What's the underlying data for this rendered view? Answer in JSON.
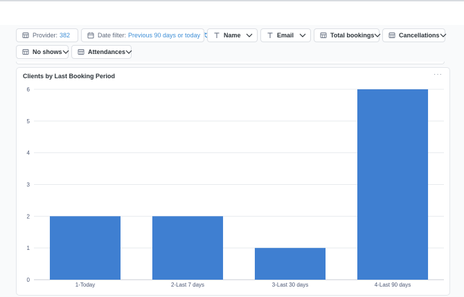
{
  "filters": [
    {
      "icon": "calendar-grid-icon",
      "label": "Provider:",
      "value": "382",
      "has_chevron": false
    },
    {
      "icon": "calendar-icon",
      "label": "Date filter:",
      "value": "Previous 90 days or today",
      "has_reset": true
    },
    {
      "icon": "text-t-icon",
      "label": "Name",
      "has_chevron": true
    },
    {
      "icon": "text-t-icon",
      "label": "Email",
      "has_chevron": true
    },
    {
      "icon": "calendar-grid-icon",
      "label": "Total bookings",
      "has_chevron": true
    },
    {
      "icon": "calendar-grid-icon",
      "label": "Cancellations",
      "has_chevron": true
    },
    {
      "icon": "calendar-grid-icon",
      "label": "No shows",
      "has_chevron": true
    },
    {
      "icon": "calendar-grid-icon",
      "label": "Attendances",
      "has_chevron": true
    }
  ],
  "card": {
    "title": "Clients by Last Booking Period",
    "menu": "···"
  },
  "colors": {
    "bar": "#3f7fd1",
    "grid": "#e8ebee",
    "accent": "#3f8fd6"
  },
  "chart_data": {
    "type": "bar",
    "title": "Clients by Last Booking Period",
    "categories": [
      "1-Today",
      "2-Last 7 days",
      "3-Last 30 days",
      "4-Last 90 days"
    ],
    "values": [
      2,
      2,
      1,
      6
    ],
    "xlabel": "",
    "ylabel": "",
    "ylim": [
      0,
      6
    ],
    "yticks": [
      0,
      1,
      2,
      3,
      4,
      5,
      6
    ],
    "grid": true
  }
}
